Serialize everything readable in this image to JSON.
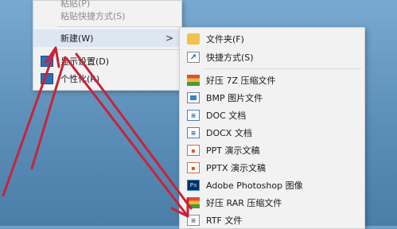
{
  "main_menu": {
    "items": [
      {
        "label": "粘贴(P)",
        "disabled": true
      },
      {
        "label": "粘贴快捷方式(S)",
        "disabled": true
      },
      {
        "label": "新建(W)",
        "disabled": false
      },
      {
        "label": "显示设置(D)",
        "disabled": false
      },
      {
        "label": "个性化(R)",
        "disabled": false
      }
    ],
    "submenu_chevron": ">"
  },
  "sub_menu": {
    "items": [
      {
        "label": "文件夹(F)",
        "icon": "folder-icon"
      },
      {
        "label": "快捷方式(S)",
        "icon": "shortcut-icon"
      },
      {
        "label": "好压 7Z 压缩文件",
        "icon": "haozip-7z-icon"
      },
      {
        "label": "BMP 图片文件",
        "icon": "bmp-file-icon"
      },
      {
        "label": "DOC 文档",
        "icon": "doc-file-icon"
      },
      {
        "label": "DOCX 文档",
        "icon": "docx-file-icon"
      },
      {
        "label": "PPT 演示文稿",
        "icon": "ppt-file-icon"
      },
      {
        "label": "PPTX 演示文稿",
        "icon": "pptx-file-icon"
      },
      {
        "label": "Adobe Photoshop 图像",
        "icon": "photoshop-file-icon"
      },
      {
        "label": "好压 RAR 压缩文件",
        "icon": "haozip-rar-icon"
      },
      {
        "label": "RTF 文件",
        "icon": "rtf-file-icon"
      }
    ]
  },
  "colors": {
    "annotation_arrow": "#c8233b",
    "menu_bg": "#f2f2f2",
    "highlight": "#dde7f2"
  }
}
